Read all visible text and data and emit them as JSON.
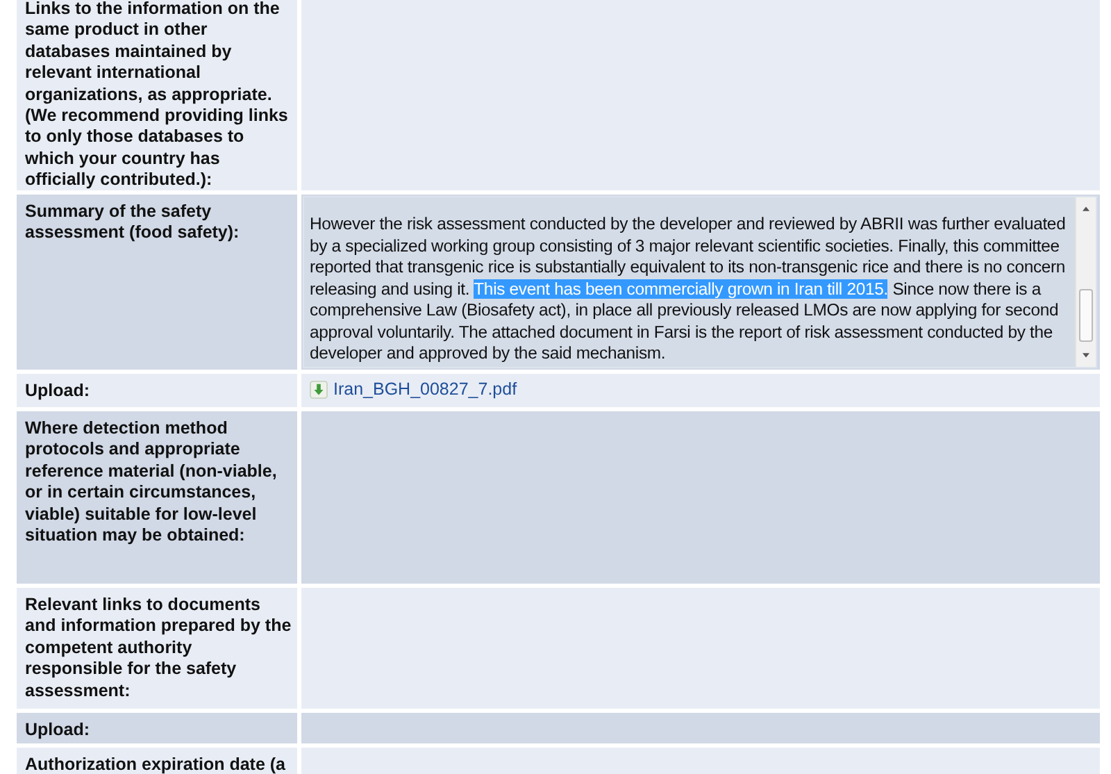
{
  "rows": [
    {
      "label": "Links to the information on the same product in other databases maintained by relevant international organizations, as appropriate. (We recommend providing links to only those databases to which your country has officially contributed.):",
      "kind": "empty"
    },
    {
      "label": "Summary of the safety assessment (food safety):",
      "kind": "textarea",
      "segments": [
        {
          "text": "However the risk assessment conducted by the developer and reviewed by ABRII was further evaluated by a specialized working group consisting of 3 major relevant scientific societies. Finally, this committee reported that transgenic rice is substantially equivalent to its non-transgenic rice and there is no concern releasing and using it. ",
          "selected": false
        },
        {
          "text": "This event has been commercially grown in Iran till 2015.",
          "selected": true
        },
        {
          "text": " Since now there is a comprehensive Law (Biosafety act), in place all previously released LMOs are now applying for second approval voluntarily. The attached document in Farsi is the report of risk assessment conducted by the developer and approved by the said mechanism.",
          "selected": false
        }
      ]
    },
    {
      "label": "Upload:",
      "kind": "file",
      "file": "Iran_BGH_00827_7.pdf"
    },
    {
      "label": "Where detection method protocols and appropriate reference material (non-viable, or in certain circumstances, viable) suitable for low-level situation may be obtained:",
      "kind": "empty"
    },
    {
      "label": "Relevant links to documents and information prepared by the competent authority responsible for the safety assessment:",
      "kind": "empty"
    },
    {
      "label": "Upload:",
      "kind": "empty"
    },
    {
      "label": "Authorization expiration date (a",
      "kind": "empty"
    }
  ]
}
